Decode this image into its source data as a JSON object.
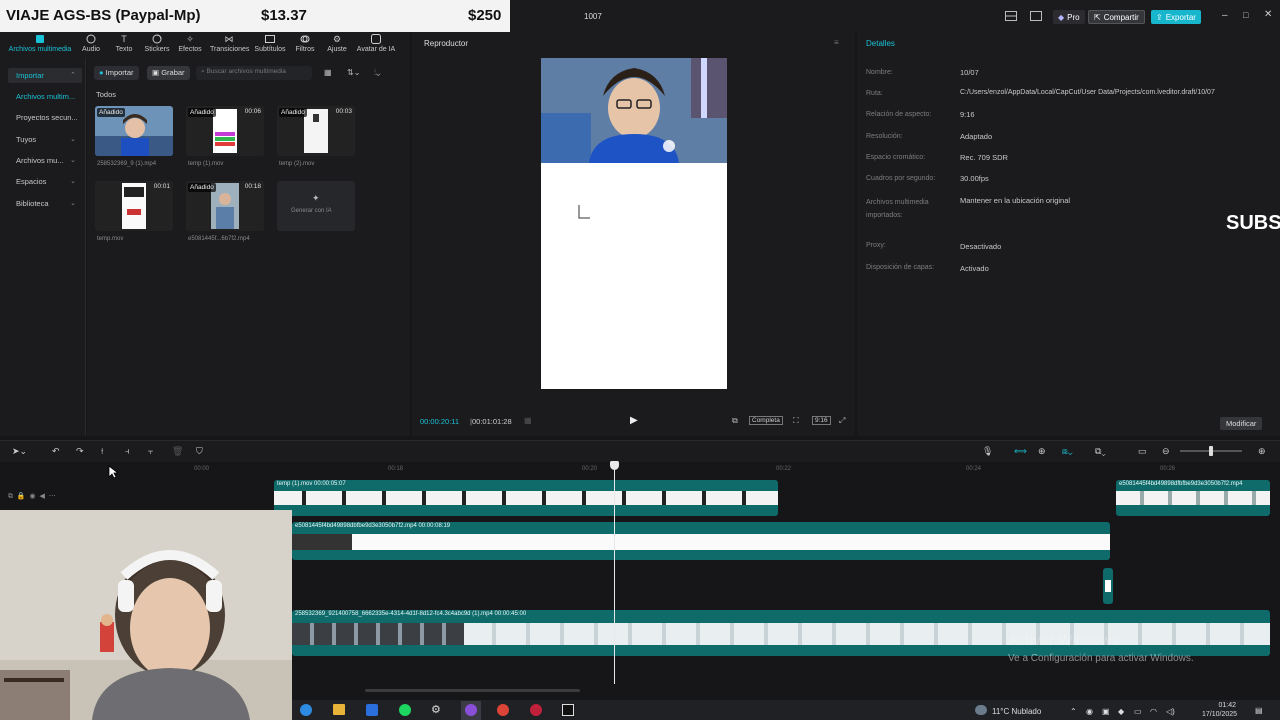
{
  "donation": {
    "title": "VIAJE AGS-BS (Paypal-Mp)",
    "amount1": "$13.37",
    "amount2": "$250"
  },
  "titlebar": {
    "project_number": "1007",
    "pro_label": "Pro",
    "share_label": "Compartir",
    "export_label": "Exportar"
  },
  "tools": [
    {
      "label": "Archivos multimedia"
    },
    {
      "label": "Audio"
    },
    {
      "label": "Texto"
    },
    {
      "label": "Stickers"
    },
    {
      "label": "Efectos"
    },
    {
      "label": "Transiciones"
    },
    {
      "label": "Subtítulos"
    },
    {
      "label": "Filtros"
    },
    {
      "label": "Ajuste"
    },
    {
      "label": "Avatar de IA"
    }
  ],
  "sidebar": {
    "items": [
      {
        "label": "Importar"
      },
      {
        "label": "Archivos multim..."
      },
      {
        "label": "Proyectos secun..."
      },
      {
        "label": "Tuyos"
      },
      {
        "label": "Archivos mu..."
      },
      {
        "label": "Espacios"
      },
      {
        "label": "Biblioteca"
      }
    ]
  },
  "media": {
    "import_label": "Importar",
    "record_label": "Grabar",
    "search_placeholder": "Buscar archivos multimedia",
    "filter_all": "Todos",
    "items": [
      {
        "badge": "Añadido",
        "duration": "",
        "caption": "258532369_9 (1).mp4"
      },
      {
        "badge": "Añadido",
        "duration": "00:06",
        "caption": "temp (1).mov"
      },
      {
        "badge": "Añadido",
        "duration": "00:03",
        "caption": "temp (2).mov"
      },
      {
        "badge": "",
        "duration": "00:01",
        "caption": "temp.mov"
      },
      {
        "badge": "Añadido",
        "duration": "00:18",
        "caption": "e5081445f...6b7f2.mp4"
      }
    ],
    "generate_label": "Generar con IA"
  },
  "player": {
    "title": "Reproductor",
    "current_time": "00:00:20:11",
    "total_time": "00:01:01:28",
    "complete_label": "Completa",
    "ratio_label": "9:16"
  },
  "details": {
    "title": "Detalles",
    "rows": [
      {
        "label": "Nombre:",
        "value": "10/07"
      },
      {
        "label": "Ruta:",
        "value": "C:/Users/enzol/AppData/Local/CapCut/User Data/Projects/com.lveditor.draft/10/07"
      },
      {
        "label": "Relación de aspecto:",
        "value": "9:16"
      },
      {
        "label": "Resolución:",
        "value": "Adaptado"
      },
      {
        "label": "Espacio cromático:",
        "value": "Rec. 709 SDR"
      },
      {
        "label": "Cuadros por segundo:",
        "value": "30.00fps"
      },
      {
        "label": "Archivos multimedia importados:",
        "value": "Mantener en la ubicación original"
      },
      {
        "label": "Proxy:",
        "value": "Desactivado"
      },
      {
        "label": "Disposición de capas:",
        "value": "Activado"
      }
    ],
    "modify_label": "Modificar",
    "overlay_text": "SUBS"
  },
  "timeline": {
    "ruler": [
      "00:00",
      "00:18",
      "00:20",
      "00:22",
      "00:24",
      "00:26"
    ],
    "clips": [
      {
        "label": "temp (1).mov  00:00:05:07"
      },
      {
        "label": "e5081445f4bd49898dfbfbe9d3e3050b7f2.mp4"
      },
      {
        "label": "e5081445f4bd49898dbfbe9d3e3050b7f2.mp4  00:00:08:19"
      },
      {
        "label": "258532369_921400758_6662335e-4314-4d1f-8d12-fc4.3c4abc9d (1).mp4  00:00:45:00"
      }
    ]
  },
  "watermark": {
    "line1": "Activar Windows",
    "line2": "Ve a Configuración para activar Windows."
  },
  "taskbar": {
    "weather": "11°C  Nublado",
    "time": "01:42",
    "date": "17/10/2025"
  }
}
